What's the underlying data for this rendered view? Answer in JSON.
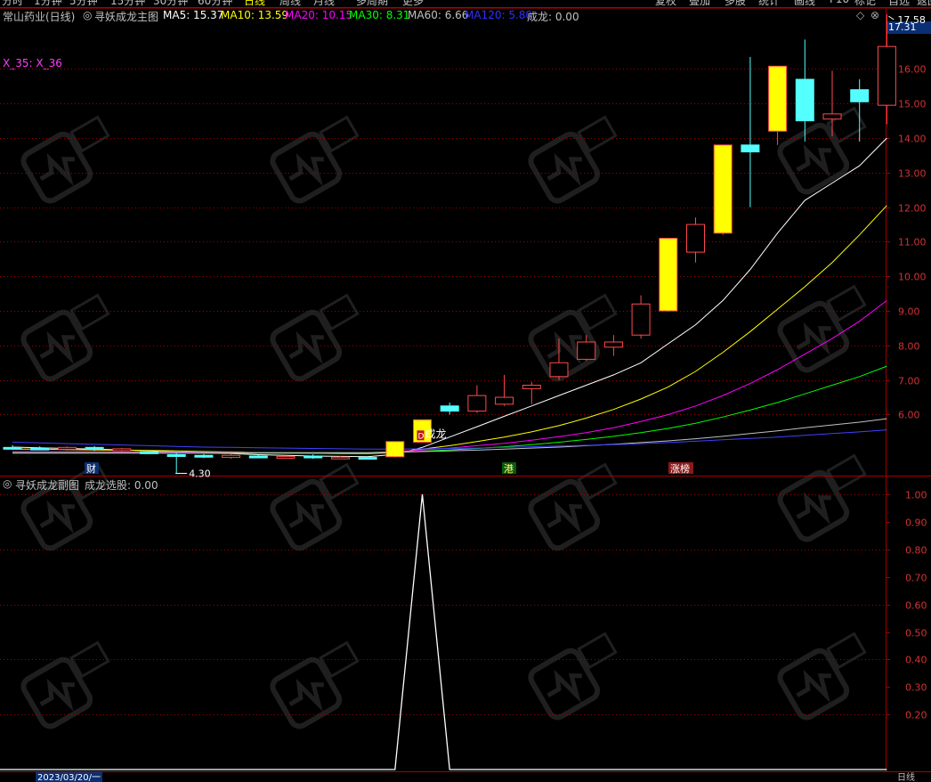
{
  "toolbar": {
    "left_items": [
      "分时",
      "1分钟",
      "5分钟",
      "15分钟",
      "30分钟",
      "60分钟",
      "日线",
      "周线",
      "月线",
      "多周期",
      "更多"
    ],
    "right_items": [
      "复权",
      "叠加",
      "多股",
      "统计",
      "画线",
      "F10",
      "标记",
      "自选",
      "返回"
    ]
  },
  "header": {
    "stock": "常山药业(日线)",
    "indicator": "寻妖成龙主图",
    "ma5": "MA5: 15.37",
    "ma10": "MA10: 13.59",
    "ma20": "MA20: 10.15",
    "ma30": "MA30: 8.31",
    "ma60": "MA60: 6.66",
    "ma120": "MA120: 5.80",
    "chenglong": "成龙: 0.00",
    "side_label": "X_35: X_36"
  },
  "sub_header": {
    "indicator": "寻妖成龙副图",
    "value": "成龙选股: 0.00"
  },
  "current_price": "17.31",
  "annotations": {
    "high": "17.58",
    "low": "4.30",
    "signal": "成龙",
    "marker_cai": "财",
    "marker_gang": "港",
    "marker_zhangbang": "涨榜",
    "marker_d": "D"
  },
  "bottom": {
    "date": "2023/03/20/一",
    "right_label": "日线"
  },
  "colors": {
    "up": "#ff4a4a",
    "down": "#54ffff",
    "limit_up": "#ffff00",
    "ma5": "#ffffff",
    "ma10": "#ffff00",
    "ma20": "#ff00ff",
    "ma30": "#00ff00",
    "ma60": "#c0c0c0",
    "ma120": "#4040ff",
    "grid": "#a00000"
  },
  "chart_data": [
    {
      "type": "candlestick",
      "ylim": [
        4.2,
        17.7
      ],
      "y_ticks": [
        6,
        7,
        8,
        9,
        10,
        11,
        12,
        13,
        14,
        15,
        16
      ],
      "candles": [
        {
          "o": 5.05,
          "h": 5.12,
          "l": 4.98,
          "c": 5.0,
          "kind": "down"
        },
        {
          "o": 5.03,
          "h": 5.08,
          "l": 4.98,
          "c": 5.02,
          "kind": "down"
        },
        {
          "o": 5.0,
          "h": 5.08,
          "l": 4.96,
          "c": 5.05,
          "kind": "up"
        },
        {
          "o": 5.05,
          "h": 5.09,
          "l": 4.95,
          "c": 5.0,
          "kind": "down"
        },
        {
          "o": 4.98,
          "h": 5.04,
          "l": 4.92,
          "c": 5.01,
          "kind": "up"
        },
        {
          "o": 4.92,
          "h": 4.96,
          "l": 4.86,
          "c": 4.9,
          "kind": "down"
        },
        {
          "o": 4.84,
          "h": 4.9,
          "l": 4.3,
          "c": 4.82,
          "kind": "down"
        },
        {
          "o": 4.82,
          "h": 4.86,
          "l": 4.74,
          "c": 4.78,
          "kind": "down"
        },
        {
          "o": 4.76,
          "h": 4.85,
          "l": 4.72,
          "c": 4.82,
          "kind": "up"
        },
        {
          "o": 4.8,
          "h": 4.84,
          "l": 4.76,
          "c": 4.79,
          "kind": "down"
        },
        {
          "o": 4.78,
          "h": 4.82,
          "l": 4.74,
          "c": 4.79,
          "kind": "up"
        },
        {
          "o": 4.8,
          "h": 4.85,
          "l": 4.72,
          "c": 4.76,
          "kind": "down"
        },
        {
          "o": 4.76,
          "h": 4.8,
          "l": 4.72,
          "c": 4.77,
          "kind": "up"
        },
        {
          "o": 4.76,
          "h": 4.8,
          "l": 4.72,
          "c": 4.75,
          "kind": "down"
        },
        {
          "o": 4.78,
          "h": 5.22,
          "l": 4.76,
          "c": 5.22,
          "kind": "limit"
        },
        {
          "o": 5.2,
          "h": 5.85,
          "l": 5.18,
          "c": 5.85,
          "kind": "limit"
        },
        {
          "o": 6.25,
          "h": 6.35,
          "l": 6.0,
          "c": 6.1,
          "kind": "down"
        },
        {
          "o": 6.1,
          "h": 6.85,
          "l": 6.05,
          "c": 6.55,
          "kind": "up"
        },
        {
          "o": 6.3,
          "h": 7.15,
          "l": 6.25,
          "c": 6.5,
          "kind": "up"
        },
        {
          "o": 6.75,
          "h": 6.95,
          "l": 6.3,
          "c": 6.85,
          "kind": "up"
        },
        {
          "o": 7.1,
          "h": 8.2,
          "l": 7.0,
          "c": 7.5,
          "kind": "up"
        },
        {
          "o": 7.6,
          "h": 8.3,
          "l": 7.55,
          "c": 8.1,
          "kind": "up"
        },
        {
          "o": 7.95,
          "h": 8.3,
          "l": 7.7,
          "c": 8.1,
          "kind": "up"
        },
        {
          "o": 8.3,
          "h": 9.45,
          "l": 8.2,
          "c": 9.2,
          "kind": "up"
        },
        {
          "o": 9.0,
          "h": 11.1,
          "l": 8.98,
          "c": 11.1,
          "kind": "limit"
        },
        {
          "o": 10.7,
          "h": 11.7,
          "l": 10.4,
          "c": 11.5,
          "kind": "up"
        },
        {
          "o": 11.25,
          "h": 13.8,
          "l": 11.2,
          "c": 13.8,
          "kind": "limit"
        },
        {
          "o": 13.8,
          "h": 16.35,
          "l": 12.0,
          "c": 13.6,
          "kind": "down"
        },
        {
          "o": 14.2,
          "h": 16.08,
          "l": 13.8,
          "c": 16.08,
          "kind": "limit"
        },
        {
          "o": 15.7,
          "h": 16.85,
          "l": 13.9,
          "c": 14.5,
          "kind": "down"
        },
        {
          "o": 14.55,
          "h": 15.95,
          "l": 14.05,
          "c": 14.7,
          "kind": "up"
        },
        {
          "o": 15.4,
          "h": 15.7,
          "l": 13.9,
          "c": 15.05,
          "kind": "down"
        },
        {
          "o": 14.95,
          "h": 17.58,
          "l": 14.4,
          "c": 16.65,
          "kind": "up"
        }
      ],
      "ma_series": [
        {
          "name": "MA5",
          "color": "#ffffff",
          "values": [
            5.06,
            5.04,
            5.02,
            5.0,
            4.98,
            4.95,
            4.92,
            4.89,
            4.87,
            4.84,
            4.82,
            4.8,
            4.79,
            4.78,
            4.85,
            5.05,
            5.35,
            5.65,
            5.95,
            6.25,
            6.55,
            6.85,
            7.15,
            7.5,
            8.05,
            8.6,
            9.3,
            10.2,
            11.25,
            12.2,
            12.7,
            13.2,
            14.0
          ]
        },
        {
          "name": "MA10",
          "color": "#ffff00",
          "values": [
            5.0,
            5.0,
            4.99,
            4.98,
            4.97,
            4.96,
            4.95,
            4.93,
            4.92,
            4.9,
            4.89,
            4.88,
            4.87,
            4.87,
            4.9,
            5.0,
            5.1,
            5.22,
            5.35,
            5.5,
            5.68,
            5.9,
            6.15,
            6.45,
            6.8,
            7.25,
            7.8,
            8.4,
            9.05,
            9.7,
            10.4,
            11.2,
            12.05
          ]
        },
        {
          "name": "MA20",
          "color": "#ff00ff",
          "values": [
            4.93,
            4.93,
            4.93,
            4.93,
            4.92,
            4.92,
            4.92,
            4.91,
            4.91,
            4.9,
            4.9,
            4.9,
            4.9,
            4.9,
            4.93,
            4.98,
            5.03,
            5.1,
            5.17,
            5.26,
            5.36,
            5.48,
            5.62,
            5.8,
            6.0,
            6.25,
            6.55,
            6.9,
            7.3,
            7.75,
            8.2,
            8.7,
            9.3
          ]
        },
        {
          "name": "MA30",
          "color": "#00ff00",
          "values": [
            4.88,
            4.88,
            4.88,
            4.88,
            4.88,
            4.88,
            4.88,
            4.88,
            4.88,
            4.88,
            4.88,
            4.88,
            4.88,
            4.89,
            4.91,
            4.94,
            4.98,
            5.02,
            5.07,
            5.13,
            5.2,
            5.28,
            5.37,
            5.48,
            5.6,
            5.75,
            5.93,
            6.13,
            6.35,
            6.6,
            6.85,
            7.1,
            7.4
          ]
        },
        {
          "name": "MA60",
          "color": "#c0c0c0",
          "values": [
            4.9,
            4.9,
            4.9,
            4.9,
            4.9,
            4.9,
            4.9,
            4.9,
            4.9,
            4.9,
            4.9,
            4.9,
            4.9,
            4.9,
            4.91,
            4.93,
            4.95,
            4.97,
            5.0,
            5.03,
            5.06,
            5.1,
            5.14,
            5.19,
            5.24,
            5.3,
            5.37,
            5.45,
            5.53,
            5.62,
            5.7,
            5.78,
            5.88
          ]
        },
        {
          "name": "MA120",
          "color": "#4040ff",
          "values": [
            5.2,
            5.18,
            5.16,
            5.14,
            5.12,
            5.1,
            5.08,
            5.06,
            5.05,
            5.04,
            5.03,
            5.02,
            5.01,
            5.0,
            5.0,
            5.01,
            5.02,
            5.03,
            5.05,
            5.07,
            5.09,
            5.11,
            5.13,
            5.16,
            5.19,
            5.23,
            5.27,
            5.31,
            5.35,
            5.4,
            5.45,
            5.5,
            5.56
          ]
        }
      ]
    },
    {
      "type": "line",
      "ylim": [
        0,
        1.05
      ],
      "y_ticks": [
        0.2,
        0.3,
        0.4,
        0.5,
        0.6,
        0.7,
        0.8,
        0.9,
        1.0
      ],
      "y_tick_labels": [
        "0.20",
        "0.30",
        "0.40",
        "0.50",
        "0.60",
        "0.70",
        "0.80",
        "0.90",
        "1.00"
      ],
      "series": [
        {
          "values": [
            0,
            0,
            0,
            0,
            0,
            0,
            0,
            0,
            0,
            0,
            0,
            0,
            0,
            0,
            0,
            1,
            0,
            0,
            0,
            0,
            0,
            0,
            0,
            0,
            0,
            0,
            0,
            0,
            0,
            0,
            0,
            0,
            0
          ]
        }
      ]
    }
  ]
}
